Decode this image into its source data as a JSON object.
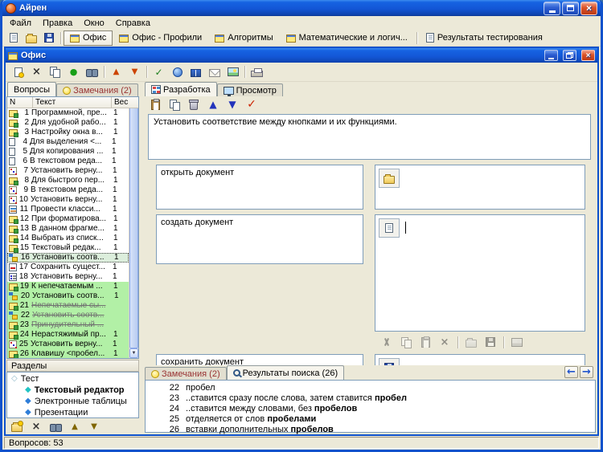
{
  "window": {
    "title": "Айрен",
    "status": "Вопросов: 53"
  },
  "menu": {
    "items": [
      "Файл",
      "Правка",
      "Окно",
      "Справка"
    ]
  },
  "main_toolbar": {
    "file_buttons": [
      "new",
      "open",
      "save"
    ],
    "tabs": [
      {
        "label": "Офис",
        "icon": "form",
        "active": true
      },
      {
        "label": "Офис - Профили",
        "icon": "form",
        "active": false
      },
      {
        "label": "Алгоритмы",
        "icon": "form",
        "active": false
      },
      {
        "label": "Математические и логич...",
        "icon": "form",
        "active": false
      },
      {
        "label": "Результаты тестирования",
        "icon": "page",
        "active": false
      }
    ]
  },
  "office_window": {
    "title": "Офис",
    "toolbar_icons": [
      "new-question",
      "delete",
      "copy",
      "run",
      "find",
      "sep",
      "move-up",
      "move-down",
      "sep",
      "check",
      "globe",
      "book",
      "mail",
      "image",
      "sep",
      "print"
    ]
  },
  "questions_panel": {
    "tab_questions": "Вопросы",
    "tab_remarks": "Замечания (2)",
    "columns": {
      "n": "N",
      "text": "Текст",
      "weight": "Вес"
    },
    "rows": [
      {
        "n": "1",
        "text": "Программной, пре...",
        "w": "1",
        "icon": "edit",
        "state": "normal"
      },
      {
        "n": "2",
        "text": "Для удобной рабо...",
        "w": "1",
        "icon": "edit",
        "state": "normal"
      },
      {
        "n": "3",
        "text": "Настройку окна в...",
        "w": "1",
        "icon": "edit",
        "state": "normal"
      },
      {
        "n": "4",
        "text": "Для выделения <...",
        "w": "1",
        "icon": "doc",
        "state": "normal"
      },
      {
        "n": "5",
        "text": "Для копирования ...",
        "w": "1",
        "icon": "doc",
        "state": "normal"
      },
      {
        "n": "6",
        "text": "В текстовом реда...",
        "w": "1",
        "icon": "doc",
        "state": "normal"
      },
      {
        "n": "7",
        "text": "Установить верну...",
        "w": "1",
        "icon": "dice",
        "state": "normal"
      },
      {
        "n": "8",
        "text": "Для быстрого пер...",
        "w": "1",
        "icon": "edit",
        "state": "normal"
      },
      {
        "n": "9",
        "text": "В текстовом реда...",
        "w": "1",
        "icon": "dice",
        "state": "normal"
      },
      {
        "n": "10",
        "text": "Установить верну...",
        "w": "1",
        "icon": "dice",
        "state": "normal"
      },
      {
        "n": "11",
        "text": "Провести класси...",
        "w": "1",
        "icon": "classify",
        "state": "normal"
      },
      {
        "n": "12",
        "text": "При форматирова...",
        "w": "1",
        "icon": "edit",
        "state": "normal"
      },
      {
        "n": "13",
        "text": "В данном фрагме...",
        "w": "1",
        "icon": "edit",
        "state": "normal"
      },
      {
        "n": "14",
        "text": "Выбрать из списк...",
        "w": "1",
        "icon": "edit",
        "state": "normal"
      },
      {
        "n": "15",
        "text": "Текстовый редак...",
        "w": "1",
        "icon": "edit",
        "state": "normal"
      },
      {
        "n": "16",
        "text": "Установить соотв...",
        "w": "1",
        "icon": "match",
        "state": "selected"
      },
      {
        "n": "17",
        "text": "Сохранить сущест...",
        "w": "1",
        "icon": "input",
        "state": "normal"
      },
      {
        "n": "18",
        "text": "Установить верну...",
        "w": "1",
        "icon": "order",
        "state": "normal"
      },
      {
        "n": "19",
        "text": "К непечатаемым ...",
        "w": "1",
        "icon": "edit",
        "state": "green"
      },
      {
        "n": "20",
        "text": "Установить соотв...",
        "w": "1",
        "icon": "match",
        "state": "green"
      },
      {
        "n": "21",
        "text": "Непечатаемые сы...",
        "w": "",
        "icon": "edit",
        "state": "green-strike"
      },
      {
        "n": "22",
        "text": "Установить соотв...",
        "w": "",
        "icon": "match",
        "state": "green-strike"
      },
      {
        "n": "23",
        "text": "Принудительный ...",
        "w": "",
        "icon": "edit",
        "state": "green-strike"
      },
      {
        "n": "24",
        "text": "Нерастяжимый пр...",
        "w": "1",
        "icon": "edit",
        "state": "green"
      },
      {
        "n": "25",
        "text": "Установить верну...",
        "w": "1",
        "icon": "dice",
        "state": "green"
      },
      {
        "n": "26",
        "text": "Клавишу <пробел...",
        "w": "1",
        "icon": "edit",
        "state": "green"
      }
    ]
  },
  "sections_panel": {
    "header": "Разделы",
    "root": "Тест",
    "items": [
      {
        "label": "Текстовый редактор",
        "current": true
      },
      {
        "label": "Электронные таблицы",
        "current": false
      },
      {
        "label": "Презентации",
        "current": false
      }
    ],
    "toolbar_icons": [
      "new-section",
      "delete",
      "find",
      "sec-up",
      "sec-down"
    ]
  },
  "editor_panel": {
    "tab_develop": "Разработка",
    "tab_preview": "Просмотр",
    "toolbar_icons": [
      "paste",
      "copy",
      "trash",
      "up-blue",
      "down-blue",
      "apply"
    ],
    "question_text": "Установить соответствие между кнопками и их функциями.",
    "pairs": [
      {
        "left": "открыть документ",
        "right_icon": "folder-open"
      },
      {
        "left": "создать документ",
        "right_icon": "page"
      },
      {
        "left": "сохранить документ",
        "right_icon": "floppy"
      }
    ],
    "editor_toolbar_icons": [
      "cut",
      "copy",
      "paste-drop",
      "delete",
      "sep",
      "folder-open",
      "floppy",
      "sep",
      "image"
    ]
  },
  "results_panel": {
    "tab_remarks": "Замечания (2)",
    "tab_search": "Результаты поиска (26)",
    "items": [
      {
        "n": "22",
        "parts": [
          {
            "t": "пробел",
            "b": false
          }
        ]
      },
      {
        "n": "23",
        "parts": [
          {
            "t": "..ставится сразу после слова, затем ставится ",
            "b": false
          },
          {
            "t": "пробел",
            "b": true
          }
        ]
      },
      {
        "n": "24",
        "parts": [
          {
            "t": "..ставится между словами, без ",
            "b": false
          },
          {
            "t": "пробелов",
            "b": true
          }
        ]
      },
      {
        "n": "25",
        "parts": [
          {
            "t": "отделяется от слов ",
            "b": false
          },
          {
            "t": "пробелами",
            "b": true
          }
        ]
      },
      {
        "n": "26",
        "parts": [
          {
            "t": "вставки дополнительных ",
            "b": false
          },
          {
            "t": "пробелов",
            "b": true
          }
        ]
      }
    ]
  },
  "colors": {
    "green_row": "#B2F0A6",
    "selection_row": "#DCEEDC",
    "titlebar_blue": "#1356D6",
    "remark_text": "#993333"
  }
}
